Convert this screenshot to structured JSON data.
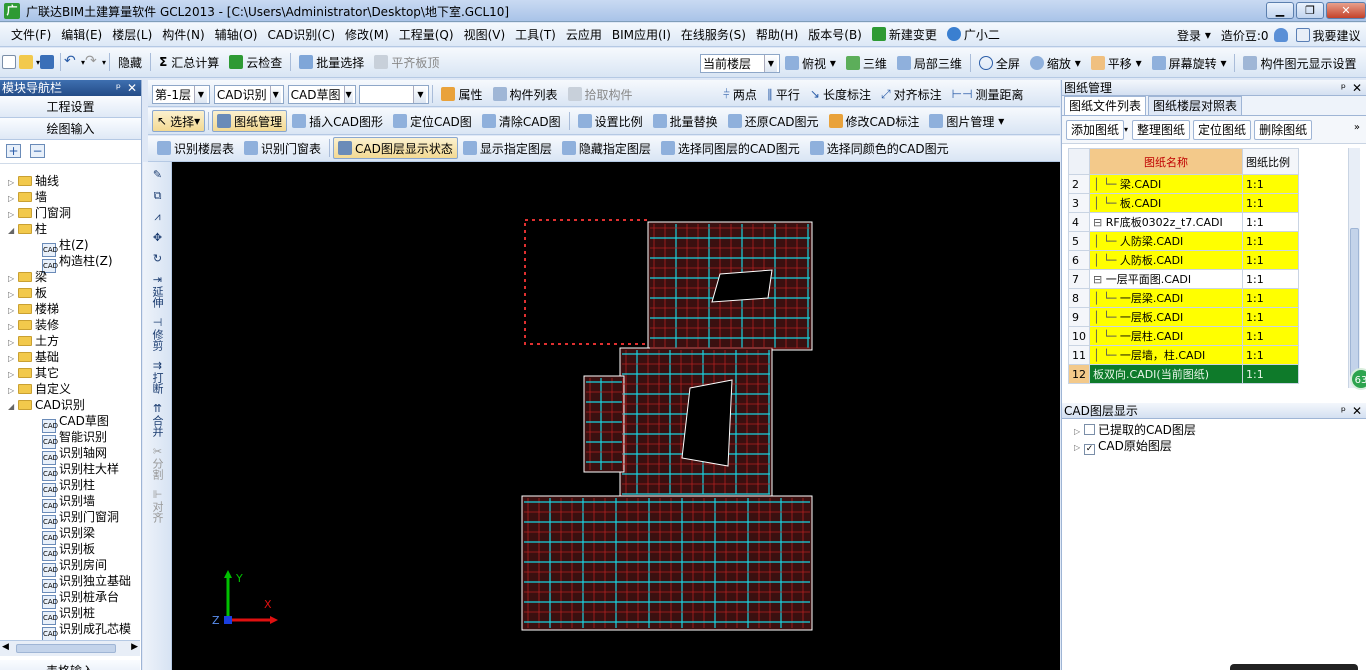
{
  "title": "广联达BIM土建算量软件 GCL2013 - [C:\\Users\\Administrator\\Desktop\\地下室.GCL10]",
  "menu": [
    "文件(F)",
    "编辑(E)",
    "楼层(L)",
    "构件(N)",
    "辅轴(O)",
    "CAD识别(C)",
    "修改(M)",
    "工程量(Q)",
    "视图(V)",
    "工具(T)",
    "云应用",
    "BIM应用(I)",
    "在线服务(S)",
    "帮助(H)",
    "版本号(B)",
    "新建变更",
    "广小二"
  ],
  "menu_right": {
    "login": "登录",
    "coins": "造价豆:0",
    "suggest": "我要建议"
  },
  "toolbar1": {
    "hide": "隐藏",
    "sum": "汇总计算",
    "cloud_check": "云检查",
    "batch_select": "批量选择",
    "flatten": "平齐板顶",
    "floor_combo": "当前楼层",
    "top_view": "俯视",
    "three_d": "三维",
    "local_3d": "局部三维",
    "full_screen": "全屏",
    "zoom": "缩放",
    "pan": "平移",
    "rotate": "屏幕旋转",
    "display_settings": "构件图元显示设置"
  },
  "toolbar2": {
    "floor": "第-1层",
    "cad_recognize": "CAD识别",
    "cad_draft": "CAD草图",
    "empty_combo": "",
    "properties": "属性",
    "component_list": "构件列表",
    "pick_component": "拾取构件",
    "two_point": "两点",
    "parallel": "平行",
    "length_dim": "长度标注",
    "align_dim": "对齐标注",
    "measure": "测量距离"
  },
  "toolbar3": {
    "select": "选择",
    "drawing_mgmt": "图纸管理",
    "insert_cad": "插入CAD图形",
    "locate_cad": "定位CAD图",
    "clear_cad": "清除CAD图",
    "set_scale": "设置比例",
    "batch_replace": "批量替换",
    "restore_cad": "还原CAD图元",
    "modify_annot": "修改CAD标注",
    "image_mgmt": "图片管理"
  },
  "toolbar4": {
    "recognize_floor_table": "识别楼层表",
    "recognize_door_table": "识别门窗表",
    "layer_display": "CAD图层显示状态",
    "show_layer": "显示指定图层",
    "hide_layer": "隐藏指定图层",
    "select_same_layer": "选择同图层的CAD图元",
    "select_same_color": "选择同颜色的CAD图元"
  },
  "left": {
    "header": "模块导航栏",
    "project_settings": "工程设置",
    "draw_input": "绘图输入",
    "bottom": "表格输入",
    "tree": [
      {
        "label": "轴线",
        "level": 0,
        "expanded": false
      },
      {
        "label": "墙",
        "level": 0,
        "expanded": false
      },
      {
        "label": "门窗洞",
        "level": 0,
        "expanded": false
      },
      {
        "label": "柱",
        "level": 0,
        "expanded": true
      },
      {
        "label": "柱(Z)",
        "level": 1
      },
      {
        "label": "构造柱(Z)",
        "level": 1
      },
      {
        "label": "梁",
        "level": 0,
        "expanded": false
      },
      {
        "label": "板",
        "level": 0,
        "expanded": false
      },
      {
        "label": "楼梯",
        "level": 0,
        "expanded": false
      },
      {
        "label": "装修",
        "level": 0,
        "expanded": false
      },
      {
        "label": "土方",
        "level": 0,
        "expanded": false
      },
      {
        "label": "基础",
        "level": 0,
        "expanded": false
      },
      {
        "label": "其它",
        "level": 0,
        "expanded": false
      },
      {
        "label": "自定义",
        "level": 0,
        "expanded": false
      },
      {
        "label": "CAD识别",
        "level": 0,
        "expanded": true
      },
      {
        "label": "CAD草图",
        "level": 1
      },
      {
        "label": "智能识别",
        "level": 1
      },
      {
        "label": "识别轴网",
        "level": 1
      },
      {
        "label": "识别柱大样",
        "level": 1
      },
      {
        "label": "识别柱",
        "level": 1
      },
      {
        "label": "识别墙",
        "level": 1
      },
      {
        "label": "识别门窗洞",
        "level": 1
      },
      {
        "label": "识别梁",
        "level": 1
      },
      {
        "label": "识别板",
        "level": 1
      },
      {
        "label": "识别房间",
        "level": 1
      },
      {
        "label": "识别独立基础",
        "level": 1
      },
      {
        "label": "识别桩承台",
        "level": 1
      },
      {
        "label": "识别桩",
        "level": 1
      },
      {
        "label": "识别成孔芯模",
        "level": 1
      }
    ]
  },
  "vtools": [
    "延伸",
    "修剪",
    "打断",
    "合并",
    "分割",
    "对齐"
  ],
  "drawing_panel": {
    "header": "图纸管理",
    "tabs": [
      "图纸文件列表",
      "图纸楼层对照表"
    ],
    "buttons": [
      "添加图纸",
      "整理图纸",
      "定位图纸",
      "删除图纸"
    ],
    "columns": [
      "图纸名称",
      "图纸比例"
    ],
    "rows": [
      {
        "n": "2",
        "name": "梁.CADI",
        "scale": "1:1",
        "style": "yellow",
        "indent": 2
      },
      {
        "n": "3",
        "name": "板.CADI",
        "scale": "1:1",
        "style": "yellow",
        "indent": 2
      },
      {
        "n": "4",
        "name": "RF底板0302z_t7.CADI",
        "scale": "1:1",
        "style": "white",
        "indent": 1
      },
      {
        "n": "5",
        "name": "人防梁.CADI",
        "scale": "1:1",
        "style": "yellow",
        "indent": 2
      },
      {
        "n": "6",
        "name": "人防板.CADI",
        "scale": "1:1",
        "style": "yellow",
        "indent": 2
      },
      {
        "n": "7",
        "name": "一层平面图.CADI",
        "scale": "1:1",
        "style": "white",
        "indent": 1
      },
      {
        "n": "8",
        "name": "一层梁.CADI",
        "scale": "1:1",
        "style": "yellow",
        "indent": 2
      },
      {
        "n": "9",
        "name": "一层板.CADI",
        "scale": "1:1",
        "style": "yellow",
        "indent": 2
      },
      {
        "n": "10",
        "name": "一层柱.CADI",
        "scale": "1:1",
        "style": "yellow",
        "indent": 2
      },
      {
        "n": "11",
        "name": "一层墙，柱.CADI",
        "scale": "1:1",
        "style": "yellow",
        "indent": 2
      },
      {
        "n": "12",
        "name": "板双向.CADI(当前图纸)",
        "scale": "1:1",
        "style": "green",
        "indent": 1
      }
    ]
  },
  "layer_panel": {
    "header": "CAD图层显示",
    "items": [
      {
        "label": "已提取的CAD图层",
        "checked": false
      },
      {
        "label": "CAD原始图层",
        "checked": true
      }
    ]
  },
  "axis": {
    "y": "Y",
    "x": "X",
    "z": "Z"
  },
  "badge": "63"
}
